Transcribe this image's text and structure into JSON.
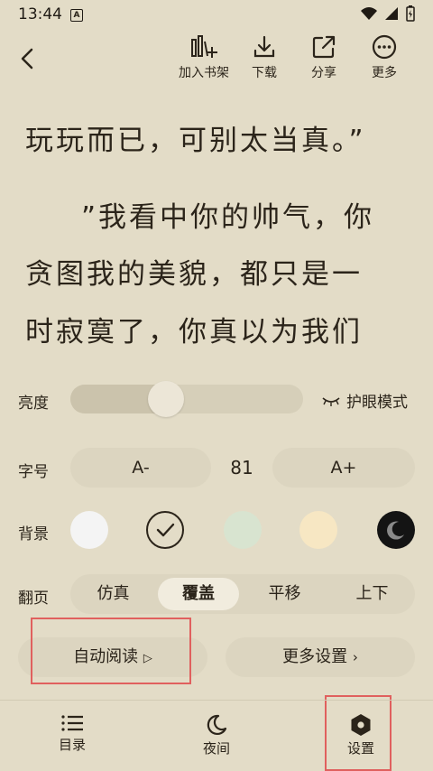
{
  "status": {
    "time": "13:44"
  },
  "toolbar": {
    "items": [
      {
        "label": "加入书架"
      },
      {
        "label": "下载"
      },
      {
        "label": "分享"
      },
      {
        "label": "更多"
      }
    ]
  },
  "reading": {
    "lines": [
      "玩玩而已，可别太当真。”",
      "”我看中你的帅气，你",
      "贪图我的美貌，都只是一",
      "时寂寞了，你真以为我们"
    ]
  },
  "settings": {
    "brightness": {
      "label": "亮度",
      "value_fraction": 0.41,
      "eye_mode": "护眼模式"
    },
    "font": {
      "label": "字号",
      "decrease": "A-",
      "value": "81",
      "increase": "A+"
    },
    "background": {
      "label": "背景",
      "swatches": [
        "#f4f4f4",
        "#e3dcc7",
        "#d8e4d0",
        "#f7e7c3",
        "#141414"
      ],
      "selected": 1
    },
    "page_turn": {
      "label": "翻页",
      "options": [
        "仿真",
        "覆盖",
        "平移",
        "上下"
      ],
      "selected": 1
    },
    "auto_read": "自动阅读",
    "more_settings": "更多设置"
  },
  "bottom_nav": [
    {
      "label": "目录"
    },
    {
      "label": "夜间"
    },
    {
      "label": "设置"
    }
  ],
  "colors": {
    "highlight": "#e0605e",
    "background": "#e3dcc7"
  }
}
